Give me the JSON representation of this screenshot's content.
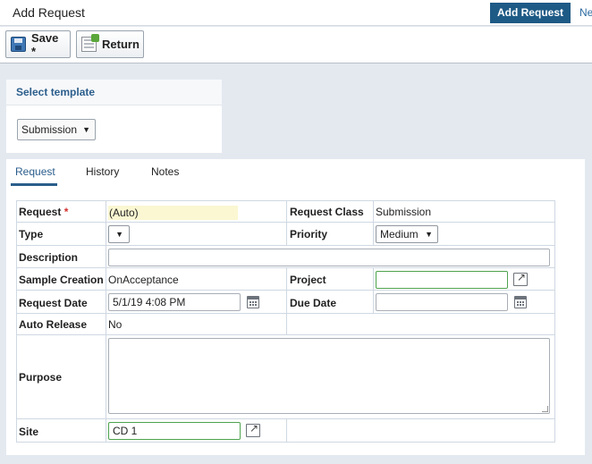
{
  "header": {
    "title": "Add Request",
    "add_request_button": "Add Request",
    "next_link": "Ne"
  },
  "toolbar": {
    "save_label": "Save *",
    "return_label": "Return"
  },
  "template": {
    "heading": "Select template",
    "selected": "Submission"
  },
  "tabs": [
    {
      "label": "Request",
      "active": true
    },
    {
      "label": "History",
      "active": false
    },
    {
      "label": "Notes",
      "active": false
    }
  ],
  "form": {
    "request_label": "Request",
    "required_marker": "*",
    "request_value": "(Auto)",
    "request_class_label": "Request Class",
    "request_class_value": "Submission",
    "type_label": "Type",
    "type_value": "",
    "priority_label": "Priority",
    "priority_value": "Medium",
    "description_label": "Description",
    "description_value": "",
    "sample_creation_label": "Sample Creation",
    "sample_creation_value": "OnAcceptance",
    "project_label": "Project",
    "project_value": "",
    "request_date_label": "Request Date",
    "request_date_value": "5/1/19 4:08 PM",
    "due_date_label": "Due Date",
    "due_date_value": "",
    "auto_release_label": "Auto Release",
    "auto_release_value": "No",
    "purpose_label": "Purpose",
    "purpose_value": "",
    "site_label": "Site",
    "site_value": "CD 1"
  }
}
